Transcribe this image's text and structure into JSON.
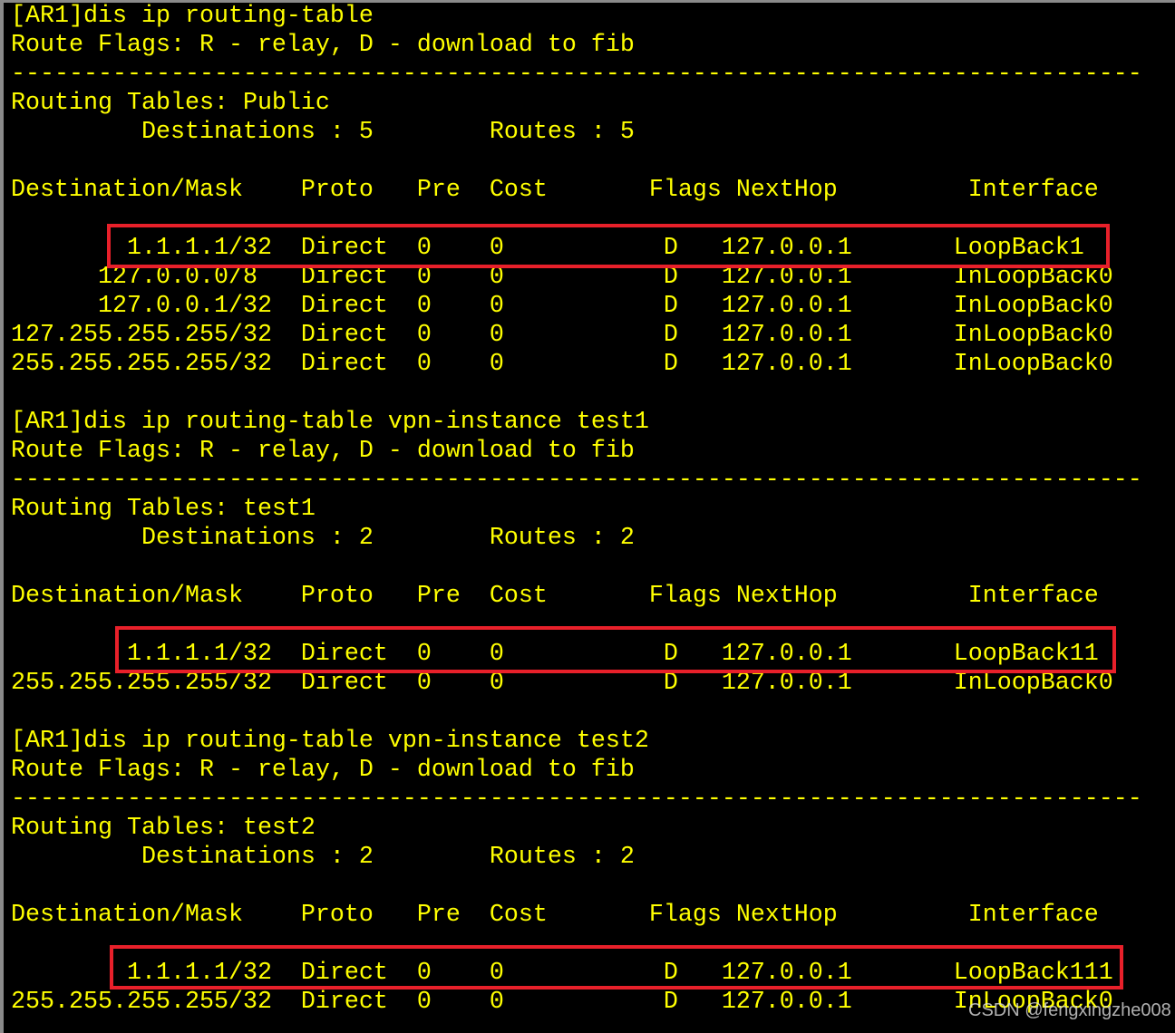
{
  "terminal": {
    "text_color": "#ffff00",
    "background": "#000000",
    "highlight_color": "#e8202a",
    "lines": [
      "[AR1]dis ip routing-table",
      "Route Flags: R - relay, D - download to fib",
      "------------------------------------------------------------------------------",
      "Routing Tables: Public",
      "         Destinations : 5        Routes : 5",
      "",
      "Destination/Mask    Proto   Pre  Cost       Flags NextHop         Interface",
      "",
      "        1.1.1.1/32  Direct  0    0           D   127.0.0.1       LoopBack1",
      "      127.0.0.0/8   Direct  0    0           D   127.0.0.1       InLoopBack0",
      "      127.0.0.1/32  Direct  0    0           D   127.0.0.1       InLoopBack0",
      "127.255.255.255/32  Direct  0    0           D   127.0.0.1       InLoopBack0",
      "255.255.255.255/32  Direct  0    0           D   127.0.0.1       InLoopBack0",
      "",
      "[AR1]dis ip routing-table vpn-instance test1",
      "Route Flags: R - relay, D - download to fib",
      "------------------------------------------------------------------------------",
      "Routing Tables: test1",
      "         Destinations : 2        Routes : 2",
      "",
      "Destination/Mask    Proto   Pre  Cost       Flags NextHop         Interface",
      "",
      "        1.1.1.1/32  Direct  0    0           D   127.0.0.1       LoopBack11",
      "255.255.255.255/32  Direct  0    0           D   127.0.0.1       InLoopBack0",
      "",
      "[AR1]dis ip routing-table vpn-instance test2",
      "Route Flags: R - relay, D - download to fib",
      "------------------------------------------------------------------------------",
      "Routing Tables: test2",
      "         Destinations : 2        Routes : 2",
      "",
      "Destination/Mask    Proto   Pre  Cost       Flags NextHop         Interface",
      "",
      "        1.1.1.1/32  Direct  0    0           D   127.0.0.1       LoopBack111",
      "255.255.255.255/32  Direct  0    0           D   127.0.0.1       InLoopBack0"
    ]
  },
  "watermark": "CSDN @fengxingzhe008"
}
